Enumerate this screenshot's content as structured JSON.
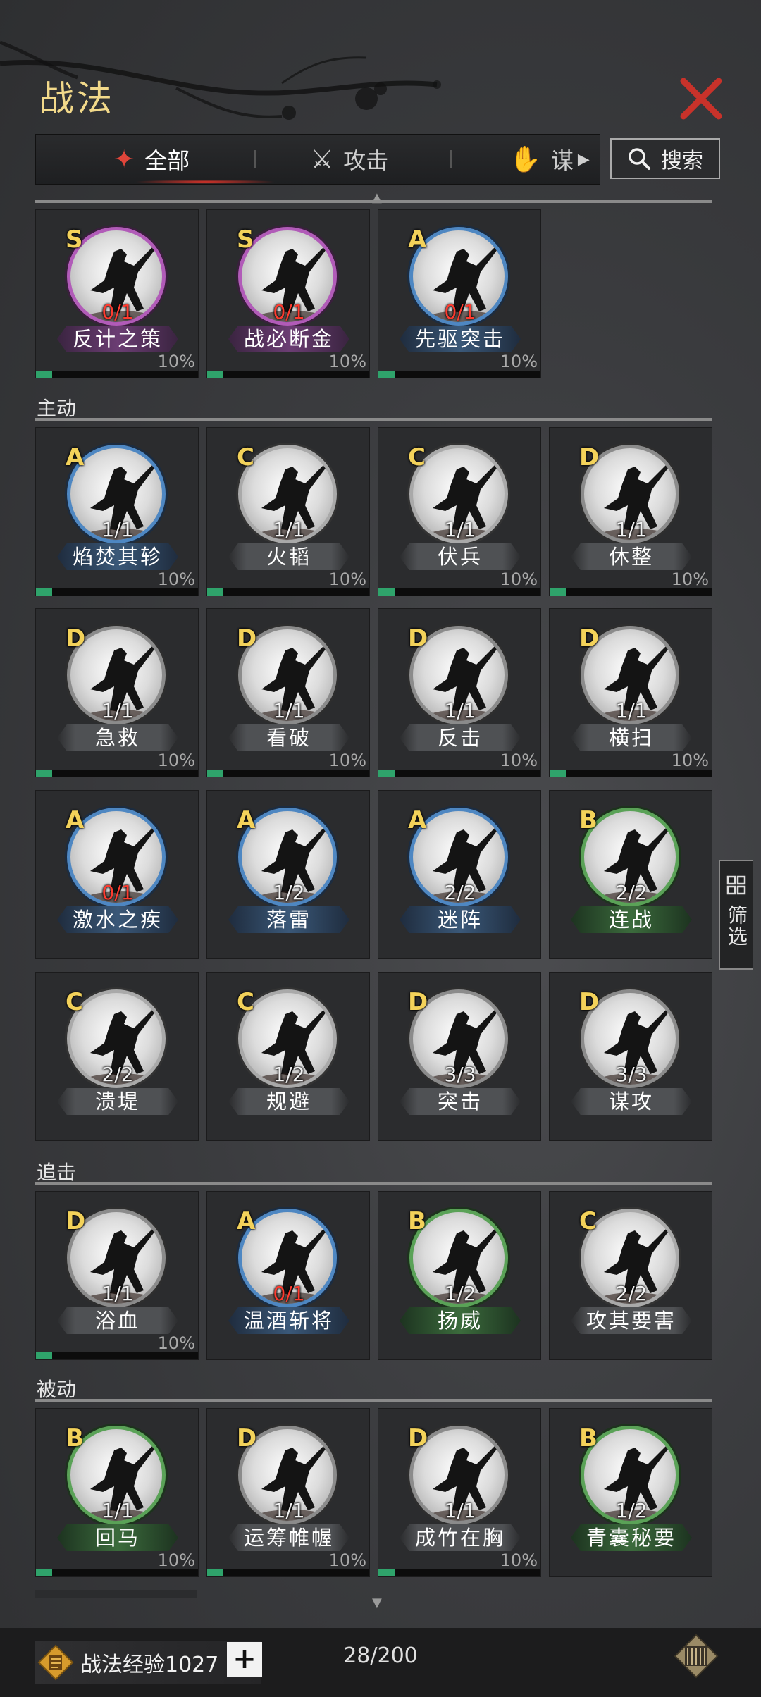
{
  "header": {
    "title": "战法"
  },
  "tabs": [
    {
      "label": "全部",
      "icon": "bundle-icon",
      "active": true
    },
    {
      "label": "攻击",
      "icon": "crossed-swords-icon",
      "active": false
    },
    {
      "label": "谋",
      "icon": "hand-icon",
      "active": false
    }
  ],
  "search": {
    "label": "搜索"
  },
  "sections": {
    "main": "主动",
    "chase": "追击",
    "passive": "被动"
  },
  "cards": [
    {
      "grade": "S",
      "count": "0/1",
      "red": true,
      "name": "反计之策",
      "pct": "10%",
      "progress": 0.1
    },
    {
      "grade": "S",
      "count": "0/1",
      "red": true,
      "name": "战必断金",
      "pct": "10%",
      "progress": 0.1
    },
    {
      "grade": "A",
      "count": "0/1",
      "red": true,
      "name": "先驱突击",
      "pct": "10%",
      "progress": 0.1
    },
    {
      "grade": "A",
      "count": "1/1",
      "red": false,
      "name": "焰焚其轸",
      "pct": "10%",
      "progress": 0.1
    },
    {
      "grade": "C",
      "count": "1/1",
      "red": false,
      "name": "火韬",
      "pct": "10%",
      "progress": 0.1
    },
    {
      "grade": "C",
      "count": "1/1",
      "red": false,
      "name": "伏兵",
      "pct": "10%",
      "progress": 0.1
    },
    {
      "grade": "D",
      "count": "1/1",
      "red": false,
      "name": "休整",
      "pct": "10%",
      "progress": 0.1
    },
    {
      "grade": "D",
      "count": "1/1",
      "red": false,
      "name": "急救",
      "pct": "10%",
      "progress": 0.1
    },
    {
      "grade": "D",
      "count": "1/1",
      "red": false,
      "name": "看破",
      "pct": "10%",
      "progress": 0.1
    },
    {
      "grade": "D",
      "count": "1/1",
      "red": false,
      "name": "反击",
      "pct": "10%",
      "progress": 0.1
    },
    {
      "grade": "D",
      "count": "1/1",
      "red": false,
      "name": "横扫",
      "pct": "10%",
      "progress": 0.1
    },
    {
      "grade": "A",
      "count": "0/1",
      "red": true,
      "name": "激水之疾",
      "pct": "",
      "progress": 0
    },
    {
      "grade": "A",
      "count": "1/2",
      "red": false,
      "name": "落雷",
      "pct": "",
      "progress": 0
    },
    {
      "grade": "A",
      "count": "2/2",
      "red": false,
      "name": "迷阵",
      "pct": "",
      "progress": 0
    },
    {
      "grade": "B",
      "count": "2/2",
      "red": false,
      "name": "连战",
      "pct": "",
      "progress": 0
    },
    {
      "grade": "C",
      "count": "2/2",
      "red": false,
      "name": "溃堤",
      "pct": "",
      "progress": 0
    },
    {
      "grade": "C",
      "count": "1/2",
      "red": false,
      "name": "规避",
      "pct": "",
      "progress": 0
    },
    {
      "grade": "D",
      "count": "3/3",
      "red": false,
      "name": "突击",
      "pct": "",
      "progress": 0
    },
    {
      "grade": "D",
      "count": "3/3",
      "red": false,
      "name": "谋攻",
      "pct": "",
      "progress": 0
    },
    {
      "grade": "D",
      "count": "1/1",
      "red": false,
      "name": "浴血",
      "pct": "10%",
      "progress": 0.1
    },
    {
      "grade": "A",
      "count": "0/1",
      "red": true,
      "name": "温酒斩将",
      "pct": "",
      "progress": 0
    },
    {
      "grade": "B",
      "count": "1/2",
      "red": false,
      "name": "扬威",
      "pct": "",
      "progress": 0
    },
    {
      "grade": "C",
      "count": "2/2",
      "red": false,
      "name": "攻其要害",
      "pct": "",
      "progress": 0
    },
    {
      "grade": "B",
      "count": "1/1",
      "red": false,
      "name": "回马",
      "pct": "10%",
      "progress": 0.1
    },
    {
      "grade": "D",
      "count": "1/1",
      "red": false,
      "name": "运筹帷幄",
      "pct": "10%",
      "progress": 0.1
    },
    {
      "grade": "D",
      "count": "1/1",
      "red": false,
      "name": "成竹在胸",
      "pct": "10%",
      "progress": 0.1
    },
    {
      "grade": "B",
      "count": "1/2",
      "red": false,
      "name": "青囊秘要",
      "pct": "",
      "progress": 0
    }
  ],
  "filter": {
    "label": "筛选"
  },
  "footer": {
    "exp_label": "战法经验1027",
    "plus": "+",
    "capacity": "28/200"
  },
  "colors": {
    "accent_gold": "#f2d98a",
    "close_red": "#c8322a",
    "progress_green": "#2fa36b",
    "count_red": "#ff3b2f"
  }
}
